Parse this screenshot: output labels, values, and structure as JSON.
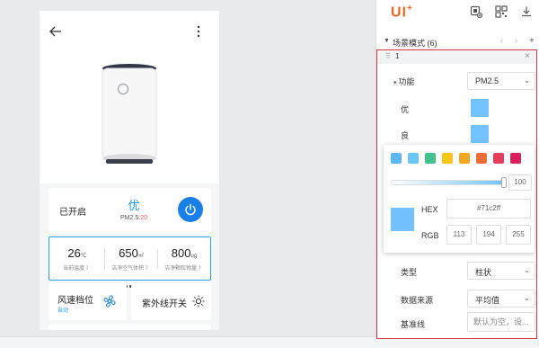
{
  "phone": {
    "status_label": "已开启",
    "aq_level": "优",
    "aq_prefix": "PM2.5:",
    "aq_value": "20",
    "metrics": [
      {
        "value": "26",
        "unit": "℃",
        "label": "当前温度 〉"
      },
      {
        "value": "650",
        "unit": "㎡",
        "label": "洁净空气体积 〉"
      },
      {
        "value": "800",
        "unit": "ug",
        "label": "洁净颗粒物量 〉"
      }
    ],
    "fan_label": "风速档位",
    "fan_sub": "自动",
    "uv_label": "紫外线开关"
  },
  "panel": {
    "logo": "UI",
    "section_title": "场景模式 (6)",
    "scene_number": "1",
    "function_label": "功能",
    "function_value": "PM2.5",
    "level_good": "优",
    "level_ok": "良",
    "hex_label": "HEX",
    "hex_value": "#71c2ff",
    "rgb_label": "RGB",
    "rgb_values": [
      "113",
      "194",
      "255"
    ],
    "alpha_value": "100",
    "type_label": "类型",
    "type_value": "柱状",
    "source_label": "数据来源",
    "source_value": "平均值",
    "baseline_label": "基准线",
    "baseline_placeholder": "默认为空，设..."
  },
  "colors": {
    "accent": "#1b7fe8",
    "selected_color": "#71c2ff",
    "highlight_border": "#d9363e",
    "presets": [
      "#5bb8f5",
      "#6cc7f2",
      "#3fc48b",
      "#f5c518",
      "#f5a623",
      "#f56b3a",
      "#e93d5f",
      "#d81e5b"
    ]
  },
  "icons": [
    "back-arrow-icon",
    "more-vertical-icon",
    "power-icon",
    "fan-icon",
    "sun-icon",
    "add-layer-icon",
    "qr-code-icon",
    "download-icon",
    "chevron-down-icon",
    "close-icon",
    "drag-handle-icon"
  ]
}
